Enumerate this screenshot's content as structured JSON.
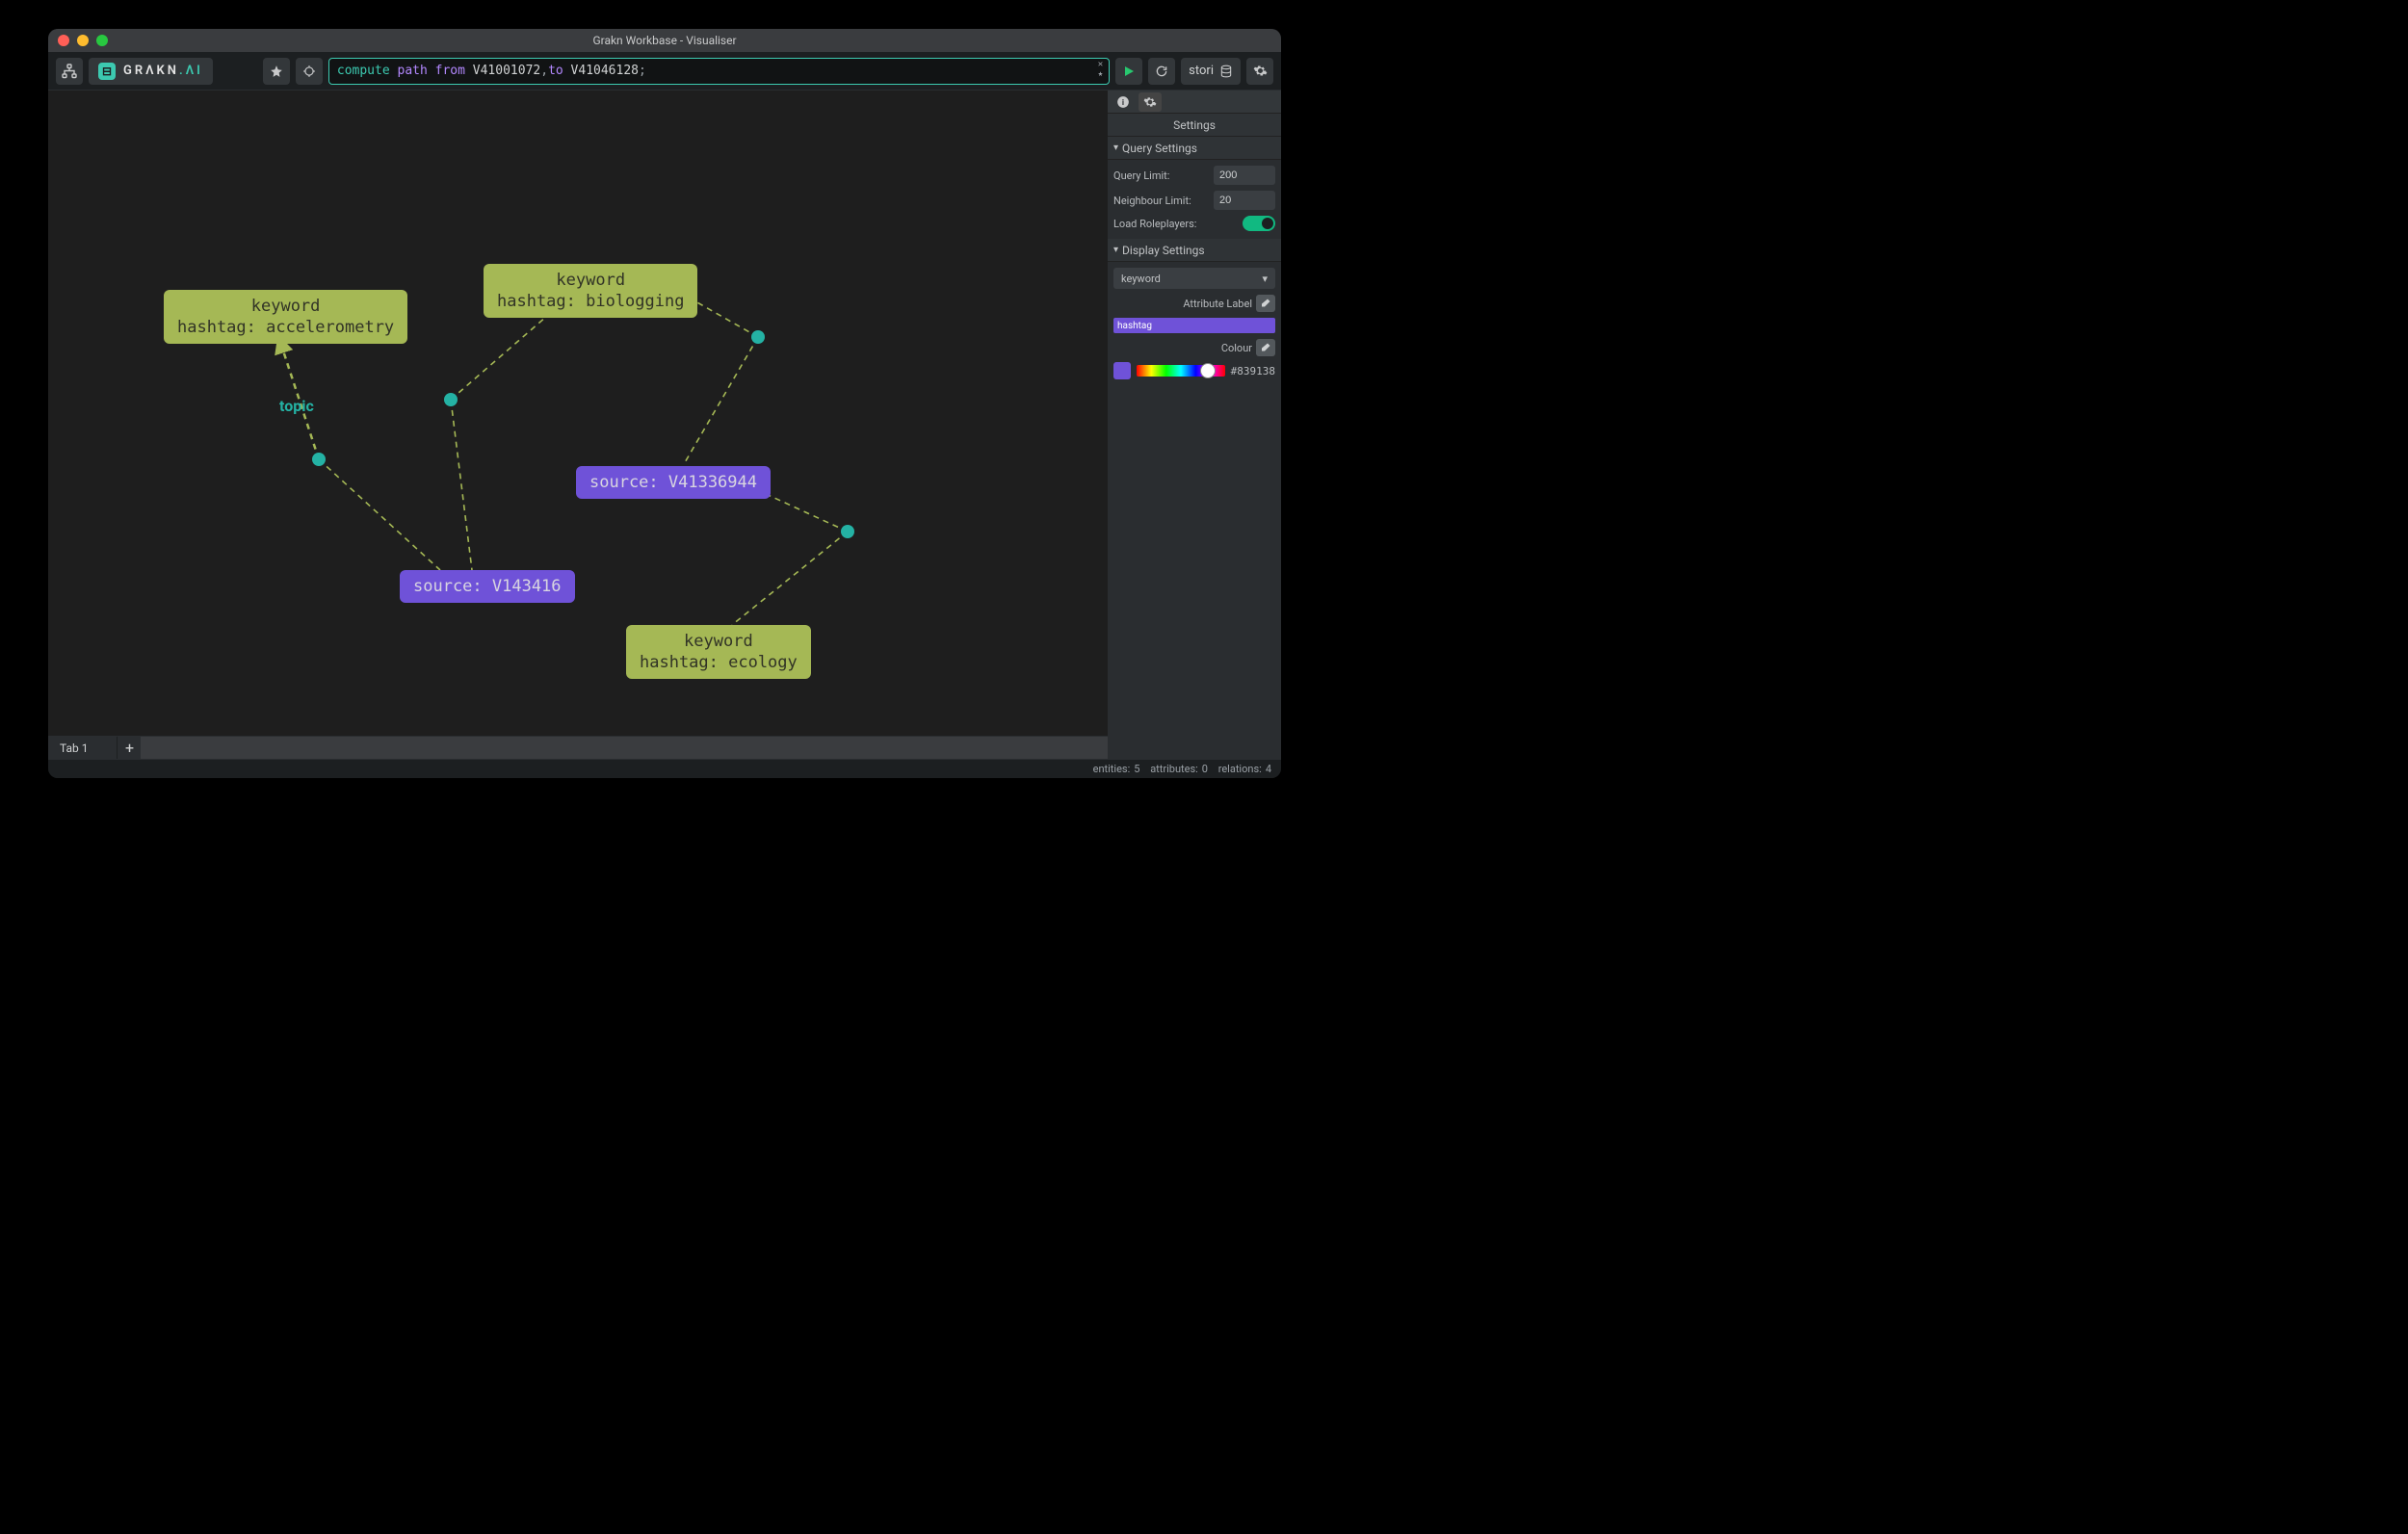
{
  "window": {
    "title": "Grakn Workbase - Visualiser"
  },
  "logo": {
    "grakn": "GRΛKN",
    "ai": ".ΛI"
  },
  "query": {
    "tokens": {
      "compute": "compute",
      "path": "path",
      "from": "from",
      "id1": "V41001072",
      "comma": ", ",
      "to": "to",
      "id2": "V41046128",
      "semi": ";"
    }
  },
  "keyspace": {
    "label": "stori"
  },
  "panel": {
    "title": "Settings",
    "query": {
      "header": "Query Settings",
      "limit_label": "Query Limit:",
      "limit_value": "200",
      "neigh_label": "Neighbour Limit:",
      "neigh_value": "20",
      "roleplayers_label": "Load Roleplayers:"
    },
    "display": {
      "header": "Display Settings",
      "type_selected": "keyword",
      "attr_label_label": "Attribute Label",
      "attr_chip": "hashtag",
      "colour_label": "Colour",
      "colour_hex": "#839138"
    }
  },
  "tabs": {
    "tab1": "Tab 1"
  },
  "status": {
    "entities_label": "entities:",
    "entities_value": "5",
    "attributes_label": "attributes:",
    "attributes_value": "0",
    "relations_label": "relations:",
    "relations_value": "4"
  },
  "graph": {
    "edge_label_topic": "topic",
    "nodes": {
      "kw_accel_l1": "keyword",
      "kw_accel_l2": "hashtag: accelerometry",
      "kw_bio_l1": "keyword",
      "kw_bio_l2": "hashtag: biologging",
      "kw_eco_l1": "keyword",
      "kw_eco_l2": "hashtag: ecology",
      "src1": "source: V41336944",
      "src2": "source: V143416"
    }
  },
  "colours": {
    "swatch": "#6f52d8"
  }
}
